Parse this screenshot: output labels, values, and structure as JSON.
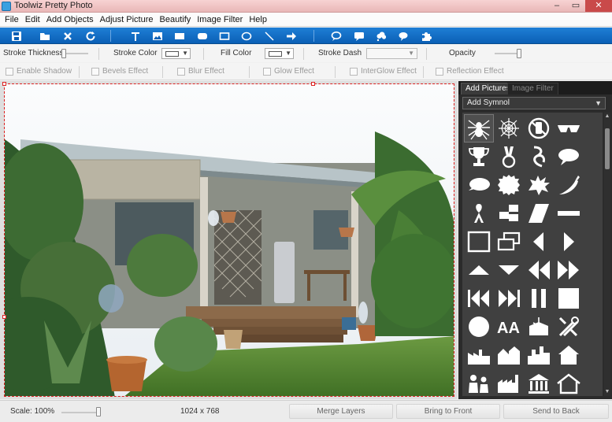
{
  "window": {
    "title": "Toolwiz Pretty Photo",
    "minimize_label": "–",
    "maximize_label": "▭",
    "close_label": "✕"
  },
  "menu": {
    "items": [
      "File",
      "Edit",
      "Add Objects",
      "Adjust Picture",
      "Beautify",
      "Image Filter",
      "Help"
    ]
  },
  "toolbar": {
    "icons": [
      "save-icon",
      "open-folder-icon",
      "close-icon",
      "refresh-icon",
      "text-tool-icon",
      "image-tool-icon",
      "filled-rectangle-icon",
      "filled-rounded-rectangle-icon",
      "rectangle-outline-icon",
      "ellipse-outline-icon",
      "line-tool-icon",
      "arrow-tool-icon",
      "speech-bubble-icon",
      "rect-callout-icon",
      "cloud-callout-icon",
      "oval-callout-icon",
      "puzzle-icon"
    ]
  },
  "properties": {
    "stroke_thickness_label": "Stroke Thickness",
    "stroke_color_label": "Stroke Color",
    "stroke_color_value": "#ffffff",
    "fill_color_label": "Fill Color",
    "fill_color_value": "#ffffff",
    "stroke_dash_label": "Stroke Dash",
    "opacity_label": "Opacity",
    "opacity_value": 1.0
  },
  "effects": {
    "enable_shadow": "Enable Shadow",
    "bevels": "Bevels Effect",
    "blur": "Blur Effect",
    "glow": "Glow Effect",
    "interglow": "InterGlow Effect",
    "reflection": "Reflection Effect"
  },
  "panel": {
    "tab_add_pictures": "Add Pictures",
    "tab_image_filter": "Image Filter",
    "symbol_select_value": "Add Symnol",
    "symbols": [
      "spider-icon",
      "spider-web-icon",
      "no-phone-icon",
      "sunglasses-icon",
      "trophy-icon",
      "medal-icon",
      "ribbon-icon",
      "speech-bubble-icon",
      "rounded-speech-bubble-icon",
      "starburst-icon",
      "explosion-icon",
      "chili-pepper-icon",
      "awareness-ribbon-icon",
      "checker-steps-icon",
      "parallelogram-icon",
      "dash-bar-icon",
      "square-frame-icon",
      "stacked-rectangles-icon",
      "left-triangle-icon",
      "right-triangle-icon",
      "up-triangle-icon",
      "down-triangle-icon",
      "rewind-icon",
      "fast-forward-icon",
      "skip-back-icon",
      "skip-forward-icon",
      "pause-icon",
      "stop-icon",
      "circle-icon",
      "font-size-icon",
      "box-compass-icon",
      "tools-icon",
      "factory-icon",
      "houses-icon",
      "city-icon",
      "house-icon",
      "people-icon",
      "industry-icon",
      "bank-icon",
      "home-icon"
    ]
  },
  "colors": {
    "accent_blue": "#0a5fb5",
    "panel_dark": "#2b2b2b",
    "selection_red": "#dd2222"
  },
  "status": {
    "scale_label": "Scale: 100%",
    "dimensions": "1024 x 768",
    "merge_layers": "Merge Layers",
    "bring_to_front": "Bring to Front",
    "send_to_back": "Send to Back"
  }
}
